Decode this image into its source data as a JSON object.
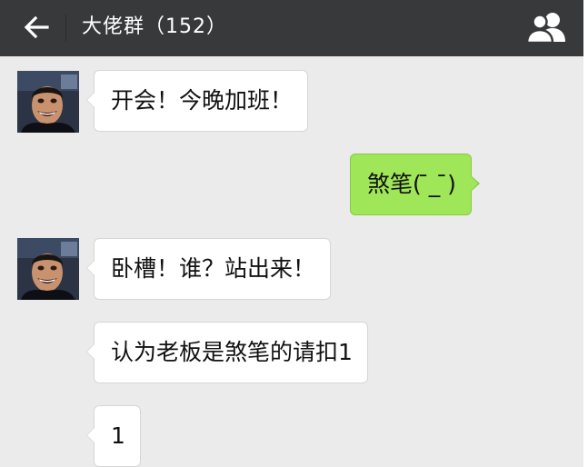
{
  "header": {
    "title": "大佬群（152）",
    "back_icon": "arrow-left-icon",
    "members_icon": "group-members-icon"
  },
  "colors": {
    "header_bg": "#37393b",
    "chat_bg": "#ebebeb",
    "incoming_bubble": "#ffffff",
    "outgoing_bubble": "#9fe658"
  },
  "messages": [
    {
      "direction": "in",
      "text": "开会！今晚加班！",
      "show_avatar": true
    },
    {
      "direction": "out",
      "text": "煞笔( ̄_ ̄)",
      "show_avatar": false
    },
    {
      "direction": "in",
      "text": "卧槽！谁？站出来！",
      "show_avatar": true
    },
    {
      "direction": "in",
      "text": "认为老板是煞笔的请扣1",
      "show_avatar": false
    },
    {
      "direction": "in",
      "text": "1",
      "show_avatar": false
    }
  ]
}
